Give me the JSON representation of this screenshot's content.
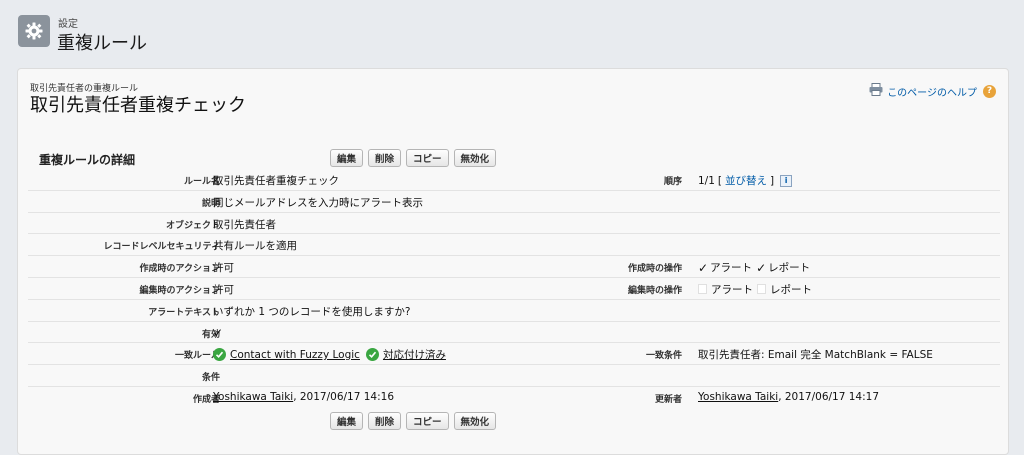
{
  "header": {
    "breadcrumb": "設定",
    "title": "重複ルール"
  },
  "page": {
    "subheader": "取引先責任者の重複ルール",
    "title": "取引先責任者重複チェック",
    "help_link": "このページのヘルプ"
  },
  "detail": {
    "section_title": "重複ルールの詳細",
    "buttons": {
      "edit": "編集",
      "delete": "削除",
      "copy": "コピー",
      "deactivate": "無効化"
    },
    "fields": {
      "rule_name_label": "ルール名",
      "rule_name": "取引先責任者重複チェック",
      "order_label": "順序",
      "order_value": "1/1",
      "order_bracket_open": "[",
      "reorder_link": "並び替え",
      "order_bracket_close": "]",
      "description_label": "説明",
      "description": "同じメールアドレスを入力時にアラート表示",
      "object_label": "オブジェクト",
      "object": "取引先責任者",
      "record_security_label": "レコードレベルセキュリティ",
      "record_security": "共有ルールを適用",
      "create_action_label": "作成時のアクション",
      "create_action": "許可",
      "create_operation_label": "作成時の操作",
      "create_alert": "アラート",
      "create_report": "レポート",
      "edit_action_label": "編集時のアクション",
      "edit_action": "許可",
      "edit_operation_label": "編集時の操作",
      "edit_alert": "アラート",
      "edit_report": "レポート",
      "alert_text_label": "アラートテキスト",
      "alert_text": "いずれか 1 つのレコードを使用しますか?",
      "active_label": "有効",
      "match_rule_label": "一致ルール",
      "match_rule_link": "Contact with Fuzzy Logic",
      "match_rule_status": "対応付け済み",
      "match_condition_label": "一致条件",
      "match_condition": "取引先責任者: Email 完全 MatchBlank = FALSE",
      "conditions_label": "条件",
      "created_by_label": "作成者",
      "created_by_user": "Yoshikawa Taiki",
      "created_by_date": ", 2017/06/17 14:16",
      "modified_by_label": "更新者",
      "modified_by_user": "Yoshikawa Taiki",
      "modified_by_date": ", 2017/06/17 14:17"
    }
  },
  "icons": {
    "setup": "gear-icon",
    "print": "printer-icon",
    "help": "help-icon",
    "info": "info-icon",
    "check": "checkmark-icon",
    "status": "green-check-icon"
  },
  "colors": {
    "link": "#015ba7",
    "status_green": "#3aa641",
    "help_orange": "#e8a33a"
  }
}
